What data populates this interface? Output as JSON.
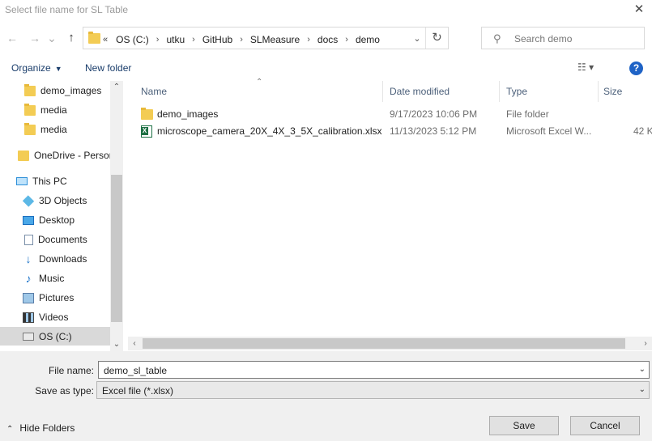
{
  "window": {
    "title": "Select file name for SL Table",
    "close_glyph": "✕"
  },
  "nav": {
    "back_glyph": "←",
    "forward_glyph": "→",
    "recent_glyph": "⌄",
    "up_glyph": "↑",
    "address_lead": "«",
    "crumbs": [
      "OS (C:)",
      "utku",
      "GitHub",
      "SLMeasure",
      "docs",
      "demo"
    ],
    "crumb_separator": "›",
    "refresh_glyph": "↻",
    "dropdown_glyph": "⌄"
  },
  "search": {
    "placeholder": "Search demo",
    "icon_glyph": "⚲"
  },
  "toolbar": {
    "organize_label": "Organize",
    "organize_caret": "▼",
    "new_folder_label": "New folder",
    "view_glyph": "☷ ▾",
    "help_glyph": "?"
  },
  "sidebar": {
    "items": [
      {
        "label": "demo_images",
        "icon": "folder-icon"
      },
      {
        "label": "media",
        "icon": "folder-icon"
      },
      {
        "label": "media",
        "icon": "folder-icon"
      },
      {
        "label": "OneDrive - Person",
        "icon": "onedrive-icon"
      },
      {
        "label": "This PC",
        "icon": "pc-icon"
      },
      {
        "label": "3D Objects",
        "icon": "3d-objects-icon"
      },
      {
        "label": "Desktop",
        "icon": "desktop-icon"
      },
      {
        "label": "Documents",
        "icon": "documents-icon"
      },
      {
        "label": "Downloads",
        "icon": "downloads-icon"
      },
      {
        "label": "Music",
        "icon": "music-icon"
      },
      {
        "label": "Pictures",
        "icon": "pictures-icon"
      },
      {
        "label": "Videos",
        "icon": "videos-icon"
      },
      {
        "label": "OS (C:)",
        "icon": "drive-icon",
        "selected": true
      }
    ],
    "scroll_up": "⌃",
    "scroll_down": "⌄"
  },
  "files": {
    "columns": {
      "name": "Name",
      "date": "Date modified",
      "type": "Type",
      "size": "Size"
    },
    "sort_glyph": "⌃",
    "rows": [
      {
        "name": "demo_images",
        "date": "9/17/2023 10:06 PM",
        "type": "File folder",
        "size": "",
        "icon": "folder-icon"
      },
      {
        "name": "microscope_camera_20X_4X_3_5X_calibration.xlsx",
        "date": "11/13/2023 5:12 PM",
        "type": "Microsoft Excel W...",
        "size": "42 K",
        "icon": "excel-file-icon"
      }
    ],
    "scroll_left": "‹",
    "scroll_right": "›"
  },
  "form": {
    "filename_label": "File name:",
    "filename_value": "demo_sl_table",
    "savetype_label": "Save as type:",
    "savetype_value": "Excel file (*.xlsx)",
    "dropdown_glyph": "⌄"
  },
  "footer": {
    "hide_folders_label": "Hide Folders",
    "hide_chevron": "⌃",
    "save_label": "Save",
    "cancel_label": "Cancel"
  },
  "colors": {
    "accent_blue": "#1f63c6",
    "folder_yellow": "#f3cc54",
    "excel_green": "#1d7044",
    "link_blue": "#1a3d6b"
  }
}
